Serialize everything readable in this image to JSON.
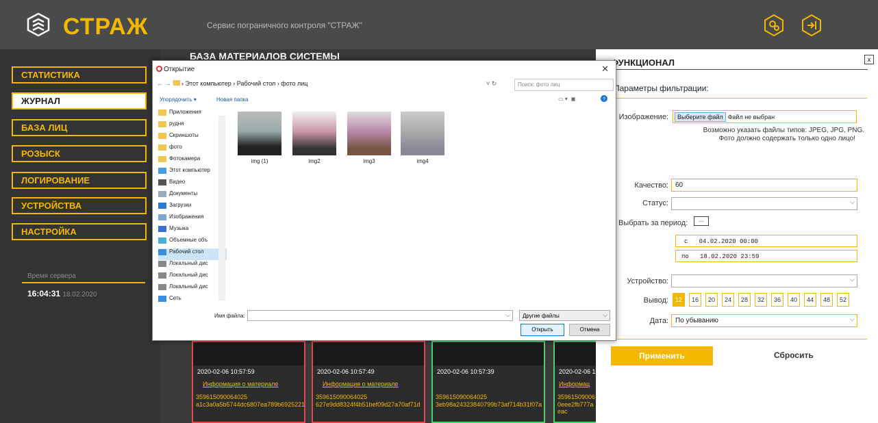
{
  "header": {
    "brand": "СТРАЖ",
    "subtitle": "Сервис пограничного контроля \"СТРАЖ\"",
    "icons": [
      "shield-logo-icon",
      "gear-icon",
      "logout-icon"
    ]
  },
  "sidebar": {
    "items": [
      {
        "label": "СТАТИСТИКА"
      },
      {
        "label": "ЖУРНАЛ"
      },
      {
        "label": "БАЗА ЛИЦ"
      },
      {
        "label": "РОЗЫСК"
      },
      {
        "label": "ЛОГИРОВАНИЕ"
      },
      {
        "label": "УСТРОЙСТВА"
      },
      {
        "label": "НАСТРОЙКА"
      }
    ],
    "server_time_label": "Время сервера",
    "server_time": "16:04:31",
    "server_date": "18.02.2020"
  },
  "main": {
    "title": "БАЗА МАТЕРИАЛОВ СИСТЕМЫ",
    "cards": [
      {
        "datetime": "2020-02-06 10:57:59",
        "info": "Информация о материале",
        "number": "359615090064025",
        "hash": "a1c3a0a5b5744dc6807ea789b6925221",
        "border": "#e04a4a"
      },
      {
        "datetime": "2020-02-06 10:57:49",
        "info": "Информация о материале",
        "number": "359615090064025",
        "hash": "627e9dd8324f4b51bef09d27a70af71d",
        "border": "#e04a4a"
      },
      {
        "datetime": "2020-02-06 10:57:39",
        "info": "",
        "number": "359615090064025",
        "hash": "3eb98a24323840799b73af714b31f07a",
        "border": "#4ad36a"
      },
      {
        "datetime": "2020-02-06 1",
        "info": "Информац",
        "number": "35961509006",
        "hash": "0eee2fb777aeac",
        "border": "#4ad36a"
      }
    ]
  },
  "filter_panel": {
    "title": "ФУНКЦИОНАЛ",
    "close": "x",
    "subtitle": "Параметры фильтрации:",
    "image_label": "Изображение:",
    "choose_file": "Выберите файл",
    "no_file": "Файл не выбран",
    "hint1": "Возможно указать файлы типов: JPEG, JPG, PNG.",
    "hint2": "Фото должно содержать только одно лицо!",
    "quality_label": "Качество:",
    "quality_value": "60",
    "status_label": "Статус:",
    "period_label": "Выбрать за период:",
    "period_btn": "...",
    "from_label": "с",
    "from_value": "04.02.2020 00:00",
    "to_label": "по",
    "to_value": "18.02.2020 23:59",
    "device_label": "Устройство:",
    "output_label": "Вывод:",
    "output_options": [
      "12",
      "16",
      "20",
      "24",
      "28",
      "32",
      "36",
      "40",
      "44",
      "48",
      "52"
    ],
    "date_label": "Дата:",
    "date_value": "По убыванию",
    "apply": "Применить",
    "reset": "Сбросить",
    "accent": "#f5b800"
  },
  "dialog": {
    "title": "Открытие",
    "address": "› Этот компьютер › Рабочий стол › фото лиц",
    "search_placeholder": "Поиск: фото лиц",
    "organize": "Упорядочить ▾",
    "new_folder": "Новая папка",
    "tree": [
      "Приложения",
      "рудня",
      "Скриншоты",
      "фото",
      "Фотокамера",
      "Этот компьютер",
      "Видео",
      "Документы",
      "Загрузки",
      "Изображения",
      "Музыка",
      "Объемные объ",
      "Рабочий стол",
      "Локальный дис",
      "Локальный дис",
      "Локальный дис",
      "Сеть"
    ],
    "files": [
      "img (1)",
      "img2",
      "img3",
      "img4"
    ],
    "filename_label": "Имя файла:",
    "filetype": "Другие файлы",
    "open": "Открыть",
    "cancel": "Отмена"
  }
}
